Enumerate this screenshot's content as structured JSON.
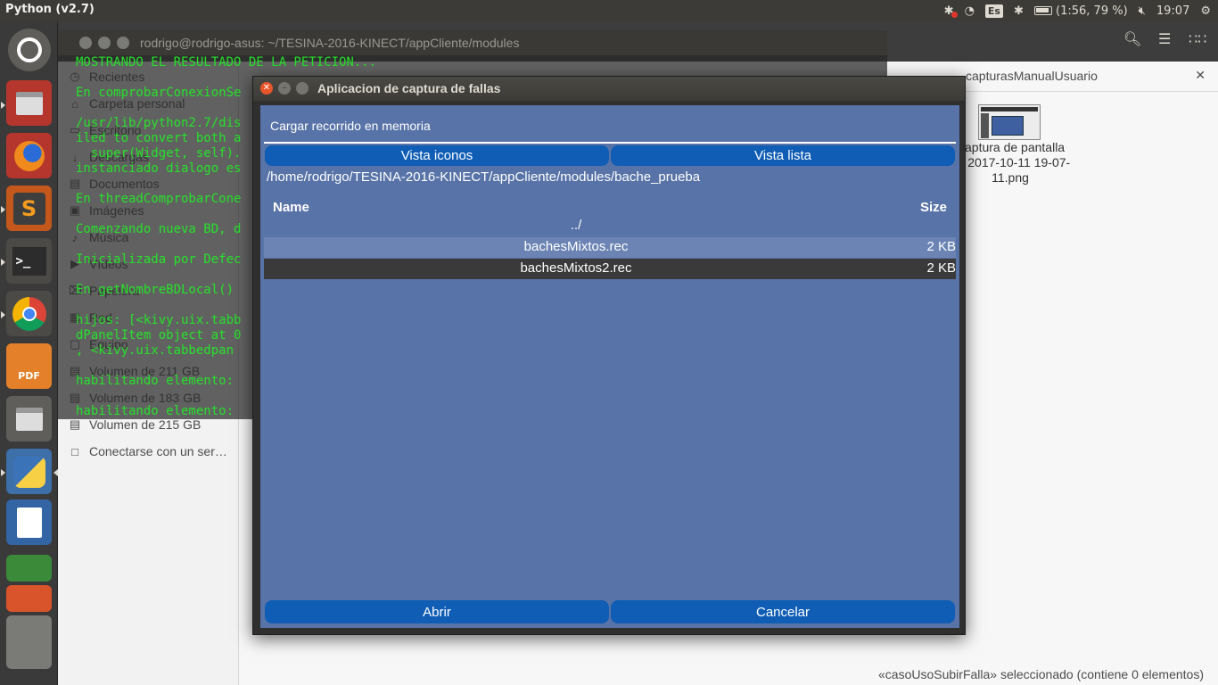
{
  "topbar": {
    "app_name": "Python (v2.7)",
    "keyboard_layout": "Es",
    "battery": "(1:56, 79 %)",
    "battery_level": 0.79,
    "clock": "19:07"
  },
  "launcher": {
    "apps": [
      "ubuntu-dash-icon",
      "files-icon",
      "firefox-icon",
      "sublime-text-icon",
      "terminal-icon",
      "chrome-icon",
      "pdf-editor-icon",
      "files-icon",
      "python-icon",
      "libreoffice-writer-icon",
      "libreoffice-calc-icon",
      "libreoffice-impress-icon",
      "trash-icon"
    ]
  },
  "file_manager": {
    "sidebar": [
      {
        "icon": "clock-icon",
        "label": "Recientes"
      },
      {
        "icon": "home-icon",
        "label": "Carpeta personal"
      },
      {
        "icon": "desktop-icon",
        "label": "Escritorio"
      },
      {
        "icon": "download-icon",
        "label": "Descargas"
      },
      {
        "icon": "document-icon",
        "label": "Documentos"
      },
      {
        "icon": "camera-icon",
        "label": "Imágenes"
      },
      {
        "icon": "music-icon",
        "label": "Música"
      },
      {
        "icon": "video-icon",
        "label": "Vídeos"
      },
      {
        "icon": "trash-icon",
        "label": "Papelera"
      },
      {
        "icon": "network-icon",
        "label": "Red"
      },
      {
        "icon": "computer-icon",
        "label": "Equipo"
      },
      {
        "icon": "drive-icon",
        "label": "Volumen de 211 GB"
      },
      {
        "icon": "drive-icon",
        "label": "Volumen de 183 GB"
      },
      {
        "icon": "drive-icon",
        "label": "Volumen de 215 GB"
      },
      {
        "icon": "server-icon",
        "label": "Conectarse con un ser…"
      }
    ],
    "tab_label": "capturasManualUsuario",
    "file_name": "Captura de pantalla de 2017-10-11 19-07-11.png",
    "status": "«casoUsoSubirFalla» seleccionado  (contiene 0 elementos)"
  },
  "terminal": {
    "title": "rodrigo@rodrigo-asus: ~/TESINA-2016-KINECT/appCliente/modules",
    "lines": [
      "MOSTRANDO EL RESULTADO DE LA PETICION...",
      "",
      "En comprobarConexionSe",
      "",
      "/usr/lib/python2.7/dis",
      "iled to convert both a",
      "  super(Widget, self).",
      "instanciado dialogo es",
      "",
      "En threadComprobarCone",
      "",
      "Comenzando nueva BD, d",
      "",
      "Inicializada por Defec",
      "",
      "En getNombreBDLocal()",
      "",
      "hijos: [<kivy.uix.tabb",
      "dPanelItem object at 0",
      ", <kivy.uix.tabbedpan",
      "",
      "habilitando elemento: ",
      "",
      "habilitando elemento: "
    ]
  },
  "dialog": {
    "title": "Aplicacion de captura de fallas",
    "heading": "Cargar recorrido en memoria",
    "view_icons_label": "Vista iconos",
    "view_list_label": "Vista lista",
    "path": "/home/rodrigo/TESINA-2016-KINECT/appCliente/modules/bache_prueba",
    "columns": {
      "name": "Name",
      "size": "Size"
    },
    "rows": [
      {
        "name": "../",
        "size": ""
      },
      {
        "name": "bachesMixtos.rec",
        "size": "2 KB"
      },
      {
        "name": "bachesMixtos2.rec",
        "size": "2 KB"
      }
    ],
    "open_label": "Abrir",
    "cancel_label": "Cancelar"
  },
  "colors": {
    "dialog_bg": "#5873a7",
    "button_bg": "#0f5db5",
    "terminal_text": "#26e22a",
    "selected_row": "#3a3a3a",
    "hover_row": "#6b84b4"
  }
}
